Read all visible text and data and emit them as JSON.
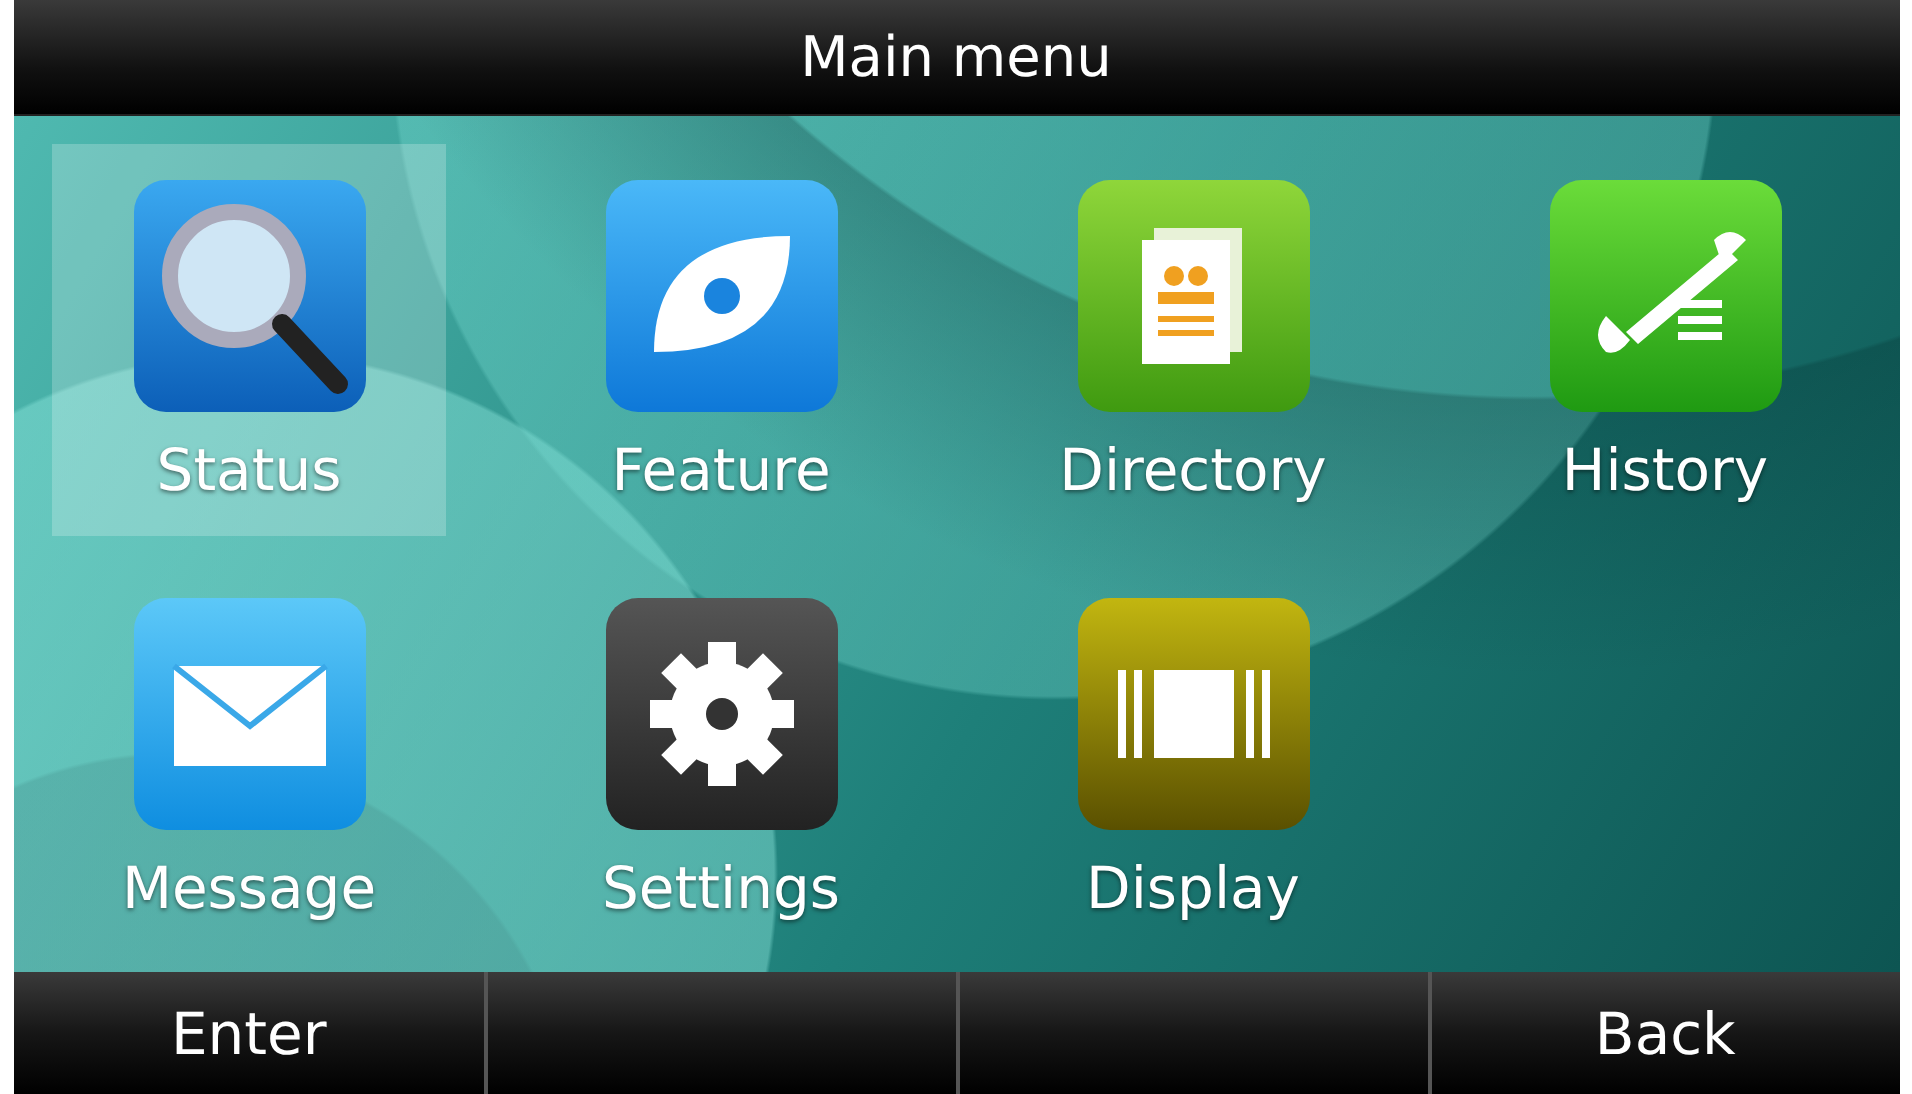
{
  "title": "Main menu",
  "items": [
    {
      "kind": "status",
      "label": "Status",
      "selected": true
    },
    {
      "kind": "feature",
      "label": "Feature",
      "selected": false
    },
    {
      "kind": "directory",
      "label": "Directory",
      "selected": false
    },
    {
      "kind": "history",
      "label": "History",
      "selected": false
    },
    {
      "kind": "message",
      "label": "Message",
      "selected": false
    },
    {
      "kind": "settings",
      "label": "Settings",
      "selected": false
    },
    {
      "kind": "display",
      "label": "Display",
      "selected": false
    }
  ],
  "softkeys": [
    {
      "kind": "left",
      "label": "Enter"
    },
    {
      "kind": "right",
      "label": "Back"
    }
  ]
}
